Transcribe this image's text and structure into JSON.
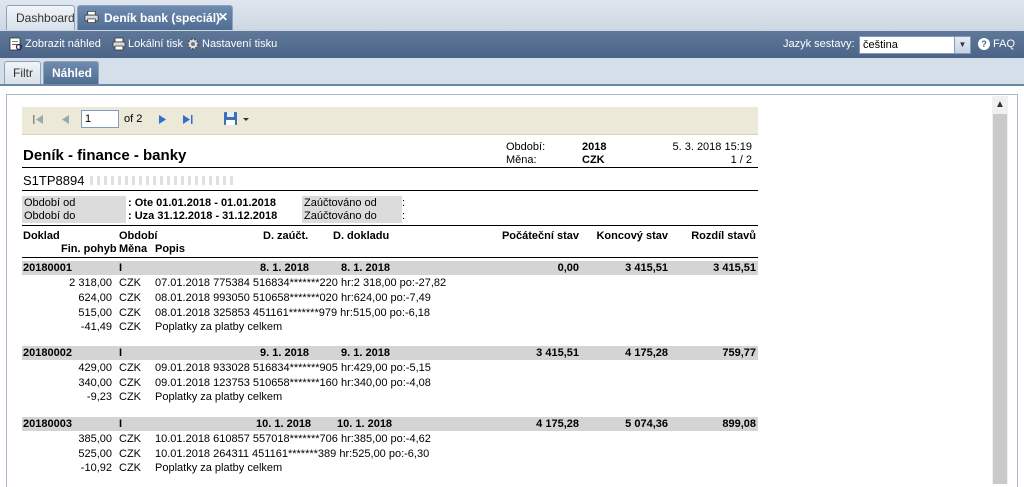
{
  "tabs": [
    {
      "label": "Dashboard",
      "active": false
    },
    {
      "label": "Deník bank (speciál)",
      "active": true,
      "close": "✕"
    }
  ],
  "toolbar": {
    "preview": "Zobrazit náhled",
    "local_print": "Lokální tisk",
    "print_settings": "Nastavení tisku",
    "lang_label": "Jazyk sestavy:",
    "lang_value": "čeština",
    "faq": "FAQ"
  },
  "subtabs": [
    "Filtr",
    "Náhled"
  ],
  "pager": {
    "page": "1",
    "of": "of 2"
  },
  "report": {
    "title": "Deník - finance - banky",
    "ident": "S1TP8894",
    "obdobi_label": "Období:",
    "obdobi_value": "2018",
    "mena_label": "Měna:",
    "mena_value": "CZK",
    "printed": "5. 3. 2018 15:19",
    "page": "1 / 2",
    "filter": {
      "od_label": "Období od",
      "od_value": ": Ote 01.01.2018 - 01.01.2018",
      "do_label": "Období do",
      "do_value": ": Uza 31.12.2018 - 31.12.2018",
      "zod_label": "Zaúčtováno od",
      "zod_value": ":",
      "zdo_label": "Zaúčtováno do",
      "zdo_value": ":"
    },
    "headers": {
      "doklad": "Doklad",
      "obdobi": "Období",
      "d_zauct": "D. zaúčt.",
      "d_dokladu": "D. dokladu",
      "pocatecni": "Počáteční stav",
      "koncovy": "Koncový stav",
      "rozdil": "Rozdíl stavů",
      "fin": "Fin. pohyb",
      "mena": "Měna",
      "popis": "Popis"
    },
    "docs": [
      {
        "doklad": "20180001",
        "obdobi": "I",
        "d_zauct": "8. 1. 2018",
        "d_dokladu": "8. 1. 2018",
        "pocatecni": "0,00",
        "koncovy": "3 415,51",
        "rozdil": "3 415,51",
        "lines": [
          {
            "amount": "2 318,00",
            "cur": "CZK",
            "desc": "07.01.2018 775384 516834*******220 hr:2 318,00 po:-27,82"
          },
          {
            "amount": "624,00",
            "cur": "CZK",
            "desc": "08.01.2018 993050 510658*******020 hr:624,00 po:-7,49"
          },
          {
            "amount": "515,00",
            "cur": "CZK",
            "desc": "08.01.2018 325853 451161*******979 hr:515,00 po:-6,18"
          },
          {
            "amount": "-41,49",
            "cur": "CZK",
            "desc": "Poplatky za platby celkem"
          }
        ]
      },
      {
        "doklad": "20180002",
        "obdobi": "I",
        "d_zauct": "9. 1. 2018",
        "d_dokladu": "9. 1. 2018",
        "pocatecni": "3 415,51",
        "koncovy": "4 175,28",
        "rozdil": "759,77",
        "lines": [
          {
            "amount": "429,00",
            "cur": "CZK",
            "desc": "09.01.2018 933028 516834*******905 hr:429,00 po:-5,15"
          },
          {
            "amount": "340,00",
            "cur": "CZK",
            "desc": "09.01.2018 123753 510658*******160 hr:340,00 po:-4,08"
          },
          {
            "amount": "-9,23",
            "cur": "CZK",
            "desc": "Poplatky za platby celkem"
          }
        ]
      },
      {
        "doklad": "20180003",
        "obdobi": "I",
        "d_zauct": "10. 1. 2018",
        "d_dokladu": "10. 1. 2018",
        "pocatecni": "4 175,28",
        "koncovy": "5 074,36",
        "rozdil": "899,08",
        "lines": [
          {
            "amount": "385,00",
            "cur": "CZK",
            "desc": "10.01.2018 610857 557018*******706 hr:385,00 po:-4,62"
          },
          {
            "amount": "525,00",
            "cur": "CZK",
            "desc": "10.01.2018 264311 451161*******389 hr:525,00 po:-6,30"
          },
          {
            "amount": "-10,92",
            "cur": "CZK",
            "desc": "Poplatky za platby celkem"
          }
        ]
      }
    ]
  },
  "icons": [
    "preview-icon",
    "printer-icon",
    "gear-icon",
    "help-icon",
    "first-page-icon",
    "prev-page-icon",
    "next-page-icon",
    "last-page-icon",
    "save-icon",
    "dropdown-arrow-icon"
  ]
}
